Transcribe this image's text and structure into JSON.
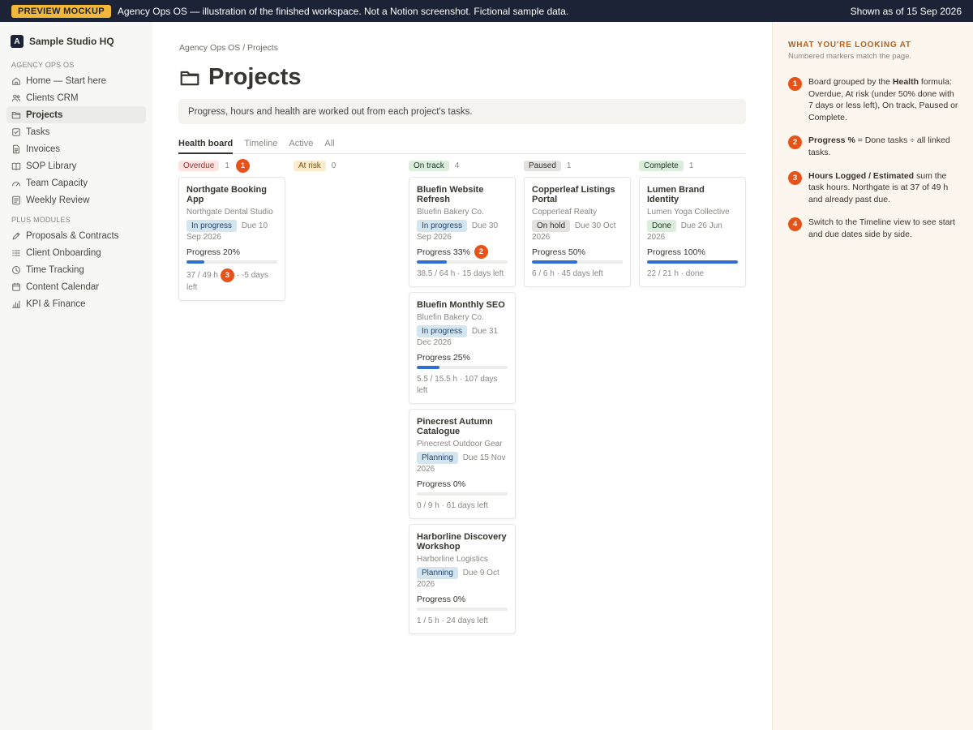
{
  "banner": {
    "pill": "PREVIEW MOCKUP",
    "message": "Agency Ops OS — illustration of the finished workspace. Not a Notion screenshot. Fictional sample data.",
    "as_of": "Shown as of 15 Sep 2026"
  },
  "sidebar": {
    "workspace_badge": "A",
    "workspace_name": "Sample Studio HQ",
    "section1": "AGENCY OPS OS",
    "items": [
      {
        "label": "Home — Start here",
        "icon": "home-icon"
      },
      {
        "label": "Clients CRM",
        "icon": "people-icon"
      },
      {
        "label": "Projects",
        "icon": "folder-icon"
      },
      {
        "label": "Tasks",
        "icon": "checkbox-icon"
      },
      {
        "label": "Invoices",
        "icon": "document-icon"
      },
      {
        "label": "SOP Library",
        "icon": "book-icon"
      },
      {
        "label": "Team Capacity",
        "icon": "gauge-icon"
      },
      {
        "label": "Weekly Review",
        "icon": "list-icon"
      }
    ],
    "section2": "PLUS MODULES",
    "plus_items": [
      {
        "label": "Proposals & Contracts",
        "icon": "pen-icon"
      },
      {
        "label": "Client Onboarding",
        "icon": "checklist-icon"
      },
      {
        "label": "Time Tracking",
        "icon": "clock-icon"
      },
      {
        "label": "Content Calendar",
        "icon": "calendar-icon"
      },
      {
        "label": "KPI & Finance",
        "icon": "bar-chart-icon"
      }
    ]
  },
  "main": {
    "breadcrumb": "Agency Ops OS / Projects",
    "title": "Projects",
    "callout": "Progress, hours and health are worked out from each project's tasks.",
    "tabs": [
      "Health board",
      "Timeline",
      "Active",
      "All"
    ]
  },
  "board": {
    "columns": [
      {
        "name": "Overdue",
        "count": "1",
        "marker": "1",
        "tag_bg": "#fde4e2",
        "tag_fg": "#93382e",
        "cards": [
          {
            "title": "Northgate Booking App",
            "client": "Northgate Dental Studio",
            "status": "In progress",
            "status_kind": "prog",
            "due": "Due 10 Sep 2026",
            "progress_label": "Progress 20%",
            "progress": 0.2,
            "hours": "37 / 49 h",
            "days": "· -5 days left",
            "hours_marker": "3"
          }
        ]
      },
      {
        "name": "At risk",
        "count": "0",
        "tag_bg": "#fbecce",
        "tag_fg": "#7a5315",
        "cards": []
      },
      {
        "name": "On track",
        "count": "4",
        "tag_bg": "#dbeddb",
        "tag_fg": "#1c3829",
        "cards": [
          {
            "title": "Bluefin Website Refresh",
            "client": "Bluefin Bakery Co.",
            "status": "In progress",
            "status_kind": "prog",
            "due": "Due 30 Sep 2026",
            "progress_label": "Progress 33%",
            "progress": 0.33,
            "progress_marker": "2",
            "foot": "38.5 / 64 h · 15 days left"
          },
          {
            "title": "Bluefin Monthly SEO",
            "client": "Bluefin Bakery Co.",
            "status": "In progress",
            "status_kind": "prog",
            "due": "Due 31 Dec 2026",
            "progress_label": "Progress 25%",
            "progress": 0.25,
            "foot": "5.5 / 15.5 h · 107 days left"
          },
          {
            "title": "Pinecrest Autumn Catalogue",
            "client": "Pinecrest Outdoor Gear",
            "status": "Planning",
            "status_kind": "plan",
            "due": "Due 15 Nov 2026",
            "progress_label": "Progress 0%",
            "progress": 0.0,
            "foot": "0 / 9 h · 61 days left"
          },
          {
            "title": "Harborline Discovery Workshop",
            "client": "Harborline Logistics",
            "status": "Planning",
            "status_kind": "plan",
            "due": "Due 9 Oct 2026",
            "progress_label": "Progress 0%",
            "progress": 0.0,
            "foot": "1 / 5 h · 24 days left"
          }
        ]
      },
      {
        "name": "Paused",
        "count": "1",
        "tag_bg": "#e3e2e0",
        "tag_fg": "#32302c",
        "cards": [
          {
            "title": "Copperleaf Listings Portal",
            "client": "Copperleaf Realty",
            "status": "On hold",
            "status_kind": "hold",
            "due": "Due 30 Oct 2026",
            "progress_label": "Progress 50%",
            "progress": 0.5,
            "foot": "6 / 6 h · 45 days left"
          }
        ]
      },
      {
        "name": "Complete",
        "count": "1",
        "tag_bg": "#dbeddb",
        "tag_fg": "#1c3829",
        "cards": [
          {
            "title": "Lumen Brand Identity",
            "client": "Lumen Yoga Collective",
            "status": "Done",
            "status_kind": "done",
            "due": "Due 26 Jun 2026",
            "progress_label": "Progress 100%",
            "progress": 1.0,
            "foot": "22 / 21 h · done"
          }
        ]
      }
    ]
  },
  "guide": {
    "title": "WHAT YOU'RE LOOKING AT",
    "subtitle": "Numbered markers match the page.",
    "items": [
      {
        "marker": "1",
        "bold": "Health",
        "pre": "Board grouped by the ",
        "post": " formula: Overdue, At risk (under 50% done with 7 days or less left), On track, Paused or Complete."
      },
      {
        "marker": "2",
        "bold": "Progress %",
        "pre": "",
        "post": " = Done tasks ÷ all linked tasks."
      },
      {
        "marker": "3",
        "bold": "Hours Logged / Estimated",
        "pre": "",
        "post": " sum the task hours. Northgate is at 37 of 49 h and already past due."
      },
      {
        "marker": "4",
        "bold": "",
        "pre": "Switch to the Timeline view to see start and due dates side by side.",
        "post": ""
      }
    ]
  },
  "colors": {
    "accent": "#e5531a",
    "banner_bg": "#1d2336",
    "pill_bg": "#f2b83a",
    "progress_fill": "#2f6fd1",
    "guide_bg": "#fdf6ee"
  }
}
